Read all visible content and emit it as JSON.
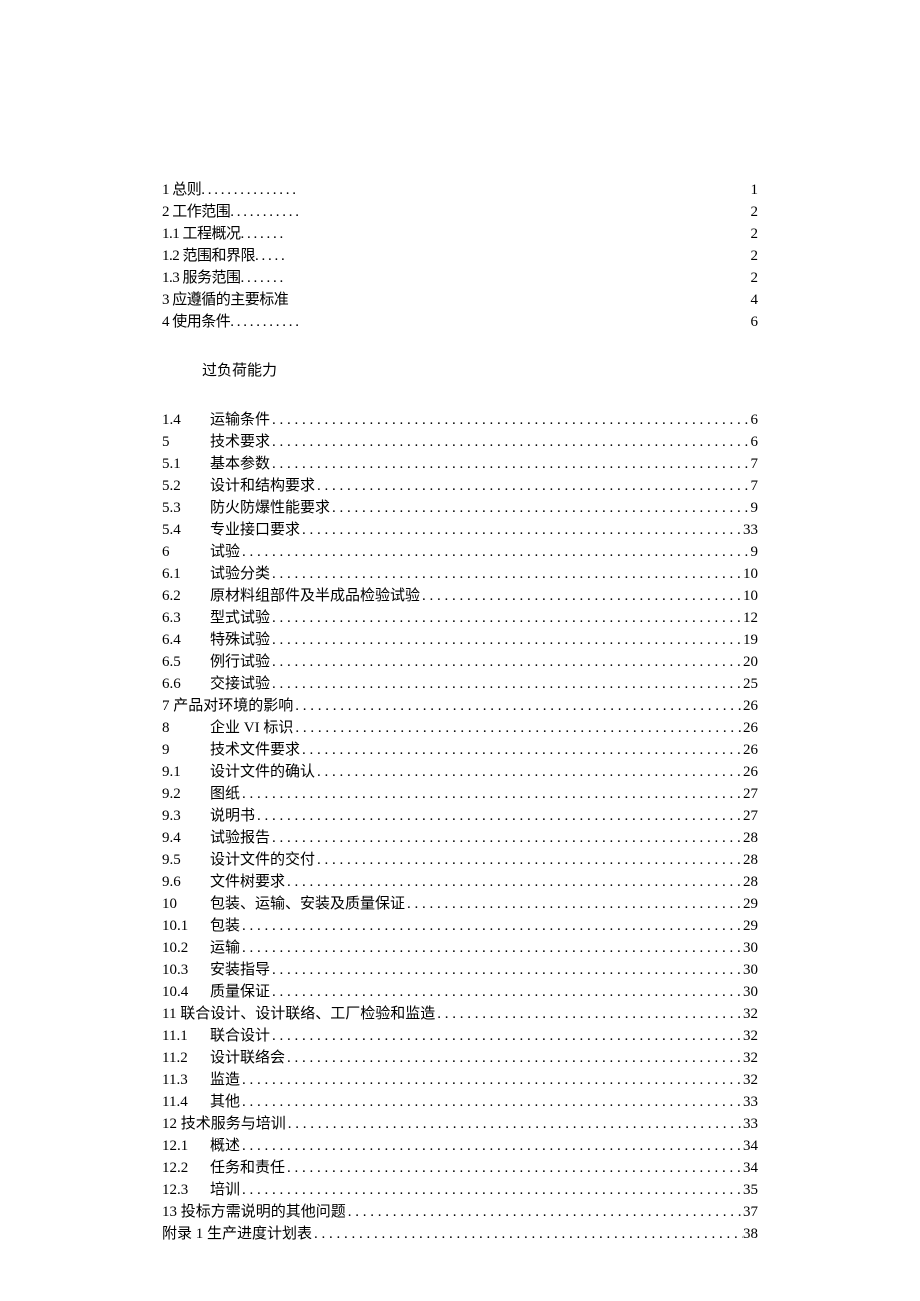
{
  "toc_top": [
    {
      "label": "1 总则",
      "dots": ". . . . . . . . . . . . . . .",
      "page": "1"
    },
    {
      "label": "2 工作范围",
      "dots": ". . . . . . . . . . .",
      "page": "2"
    },
    {
      "label": "1.1    工程概况",
      "dots": ". . . . . . .",
      "page": "2"
    },
    {
      "label": "1.2    范围和界限",
      "dots": ". . . . .",
      "page": "2"
    },
    {
      "label": "1.3    服务范围",
      "dots": ". . . . . . .",
      "page": "2"
    },
    {
      "label": "3 应遵循的主要标准",
      "dots": "",
      "page": "4"
    },
    {
      "label": "4 使用条件",
      "dots": ". . . . . . . . . . .",
      "page": "6"
    }
  ],
  "heading": "过负荷能力",
  "toc_main": [
    {
      "num": "1.4",
      "title": "运输条件",
      "page": "6"
    },
    {
      "num": "5",
      "title": "技术要求",
      "page": "6"
    },
    {
      "num": "5.1",
      "title": "基本参数",
      "page": "7"
    },
    {
      "num": "5.2",
      "title": "设计和结构要求",
      "page": "7"
    },
    {
      "num": "5.3",
      "title": "防火防爆性能要求",
      "page": "9"
    },
    {
      "num": "5.4",
      "title": "专业接口要求",
      "page": "33"
    },
    {
      "num": "6",
      "title": "试验",
      "page": "9"
    },
    {
      "num": "6.1",
      "title": "试验分类",
      "page": "10"
    },
    {
      "num": "6.2",
      "title": "原材料组部件及半成品检验试验",
      "page": "10"
    },
    {
      "num": "6.3",
      "title": "型式试验",
      "page": "12"
    },
    {
      "num": "6.4",
      "title": "特殊试验",
      "page": "19"
    },
    {
      "num": "6.5",
      "title": "例行试验",
      "page": "20"
    },
    {
      "num": "6.6",
      "title": "交接试验",
      "page": "25"
    },
    {
      "num": "",
      "title": "7 产品对环境的影响",
      "page": "26",
      "nonum": true
    },
    {
      "num": "8",
      "title": "企业 VI 标识",
      "page": "26"
    },
    {
      "num": "9",
      "title": "技术文件要求",
      "page": "26"
    },
    {
      "num": "9.1",
      "title": "设计文件的确认",
      "page": "26"
    },
    {
      "num": "9.2",
      "title": "图纸",
      "page": "27"
    },
    {
      "num": "9.3",
      "title": "说明书",
      "page": "27"
    },
    {
      "num": "9.4",
      "title": "试验报告",
      "page": "28"
    },
    {
      "num": "9.5",
      "title": "设计文件的交付",
      "page": "28"
    },
    {
      "num": "9.6",
      "title": "文件树要求",
      "page": "28"
    },
    {
      "num": "10",
      "title": "包装、运输、安装及质量保证",
      "page": "29"
    },
    {
      "num": "10.1",
      "title": "包装",
      "page": "29"
    },
    {
      "num": "10.2",
      "title": "运输",
      "page": "30"
    },
    {
      "num": "10.3",
      "title": "安装指导",
      "page": "30"
    },
    {
      "num": "10.4",
      "title": "质量保证",
      "page": "30"
    },
    {
      "num": "",
      "title": "11 联合设计、设计联络、工厂检验和监造",
      "page": "32",
      "nonum": true
    },
    {
      "num": "11.1",
      "title": "联合设计",
      "page": "32"
    },
    {
      "num": "11.2",
      "title": "设计联络会",
      "page": "32"
    },
    {
      "num": "11.3",
      "title": "监造",
      "page": "32"
    },
    {
      "num": "11.4",
      "title": "其他",
      "page": "33"
    },
    {
      "num": "",
      "title": "12 技术服务与培训",
      "page": "33",
      "nonum": true
    },
    {
      "num": "12.1",
      "title": "概述",
      "page": "34"
    },
    {
      "num": "12.2",
      "title": "任务和责任",
      "page": "34"
    },
    {
      "num": "12.3",
      "title": "培训",
      "page": "35"
    },
    {
      "num": "",
      "title": "13 投标方需说明的其他问题",
      "page": "37",
      "nonum": true
    },
    {
      "num": "",
      "title": "附录 1 生产进度计划表",
      "page": "38",
      "nonum": true
    }
  ]
}
